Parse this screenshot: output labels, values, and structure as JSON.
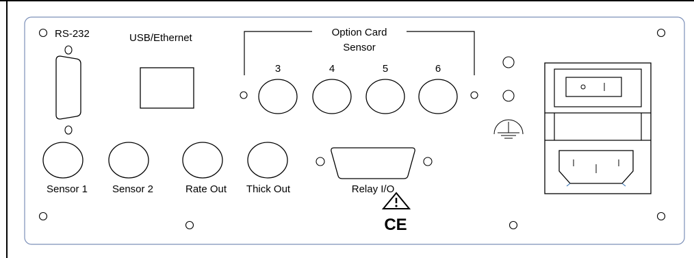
{
  "panel": {
    "labels": {
      "rs232": "RS-232",
      "usb_ethernet": "USB/Ethernet",
      "option_card": "Option Card",
      "sensor": "Sensor",
      "slot3": "3",
      "slot4": "4",
      "slot5": "5",
      "slot6": "6",
      "sensor1": "Sensor 1",
      "sensor2": "Sensor 2",
      "rate_out": "Rate Out",
      "thick_out": "Thick Out",
      "relay_io": "Relay I/O",
      "ce_mark": "CE"
    },
    "colors": {
      "panel_border": "#7b8fb8",
      "ink": "#000000"
    }
  }
}
